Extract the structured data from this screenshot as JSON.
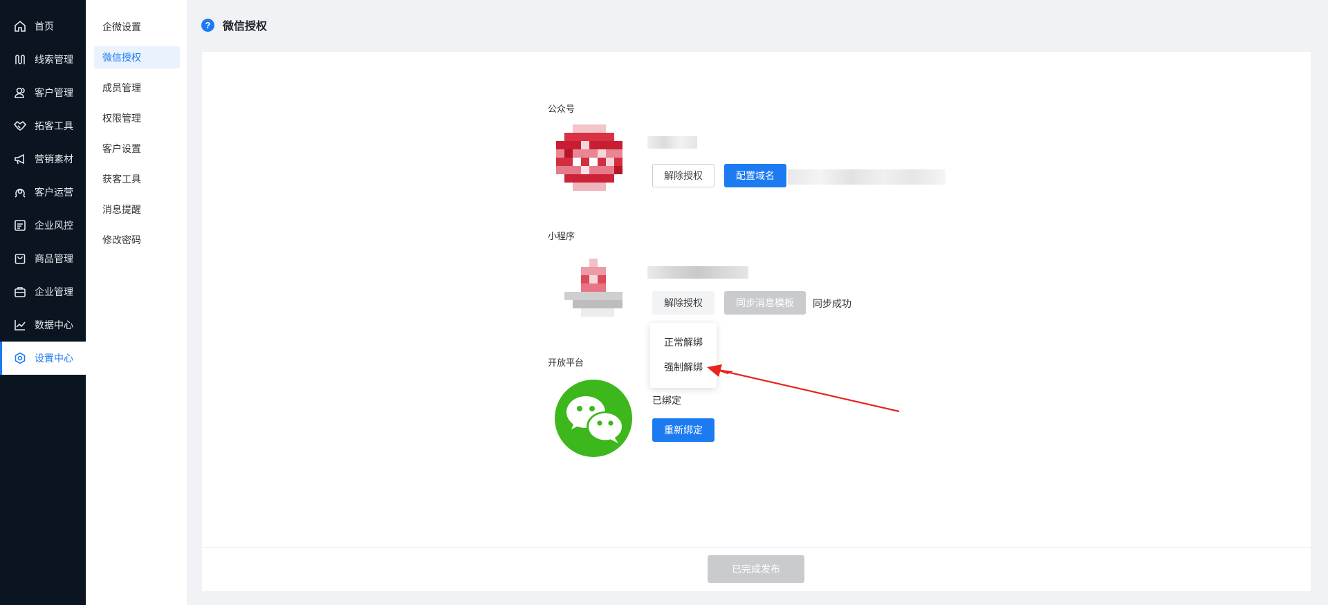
{
  "nav": {
    "items": [
      {
        "label": "首页",
        "icon": "home-icon"
      },
      {
        "label": "线索管理",
        "icon": "clue-icon"
      },
      {
        "label": "客户管理",
        "icon": "users-icon"
      },
      {
        "label": "拓客工具",
        "icon": "handshake-icon"
      },
      {
        "label": "营销素材",
        "icon": "megaphone-icon"
      },
      {
        "label": "客户运营",
        "icon": "operation-icon"
      },
      {
        "label": "企业风控",
        "icon": "risk-icon"
      },
      {
        "label": "商品管理",
        "icon": "shopping-bag-icon"
      },
      {
        "label": "企业管理",
        "icon": "briefcase-icon"
      },
      {
        "label": "数据中心",
        "icon": "chart-line-icon"
      },
      {
        "label": "设置中心",
        "icon": "gear-icon"
      }
    ],
    "active_index": 10
  },
  "submenu": {
    "items": [
      "企微设置",
      "微信授权",
      "成员管理",
      "权限管理",
      "客户设置",
      "获客工具",
      "消息提醒",
      "修改密码"
    ],
    "active_index": 1
  },
  "page": {
    "help_icon": "?",
    "title": "微信授权"
  },
  "official_account": {
    "label": "公众号",
    "unbind_button": "解除授权",
    "config_domain_button": "配置域名"
  },
  "mini_program": {
    "label": "小程序",
    "unbind_button": "解除授权",
    "sync_template_button": "同步消息模板",
    "sync_status": "同步成功"
  },
  "dropdown": {
    "items": [
      "正常解绑",
      "强制解绑"
    ]
  },
  "open_platform": {
    "label": "开放平台",
    "status": "已绑定",
    "rebind_button": "重新绑定"
  },
  "footer": {
    "publish_button": "已完成发布"
  },
  "colors": {
    "accent": "#1d7bf2",
    "sidebar_bg": "#0b1521",
    "wechat_green": "#3cb71c",
    "arrow_red": "#e8231d"
  }
}
